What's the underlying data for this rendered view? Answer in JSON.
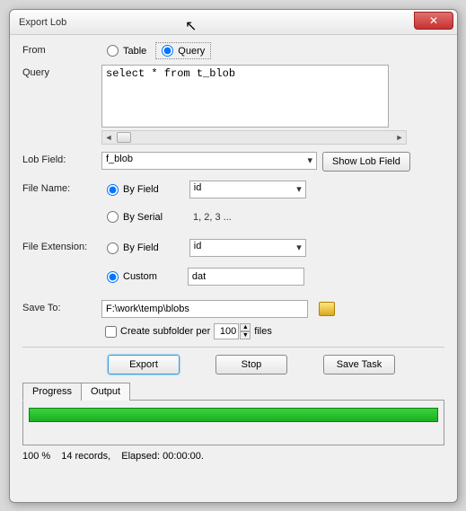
{
  "title": "Export Lob",
  "labels": {
    "from": "From",
    "query": "Query",
    "lobfield": "Lob Field:",
    "filename": "File Name:",
    "fileext": "File Extension:",
    "saveto": "Save To:"
  },
  "fromRadios": {
    "table": "Table",
    "query": "Query"
  },
  "queryText": "select * from t_blob",
  "lobFieldValue": "f_blob",
  "showLobBtn": "Show Lob Field",
  "fileName": {
    "byField": "By Field",
    "bySerial": "By Serial",
    "fieldValue": "id",
    "serialHint": "1, 2, 3 ..."
  },
  "fileExt": {
    "byField": "By Field",
    "custom": "Custom",
    "fieldValue": "id",
    "customValue": "dat"
  },
  "saveToPath": "F:\\work\\temp\\blobs",
  "subfolder": {
    "label": "Create subfolder per",
    "value": "100",
    "files": "files"
  },
  "buttons": {
    "export": "Export",
    "stop": "Stop",
    "saveTask": "Save Task"
  },
  "tabs": {
    "progress": "Progress",
    "output": "Output"
  },
  "status": {
    "percent": "100 %",
    "records": "14 records,",
    "elapsed": "Elapsed: 00:00:00."
  }
}
